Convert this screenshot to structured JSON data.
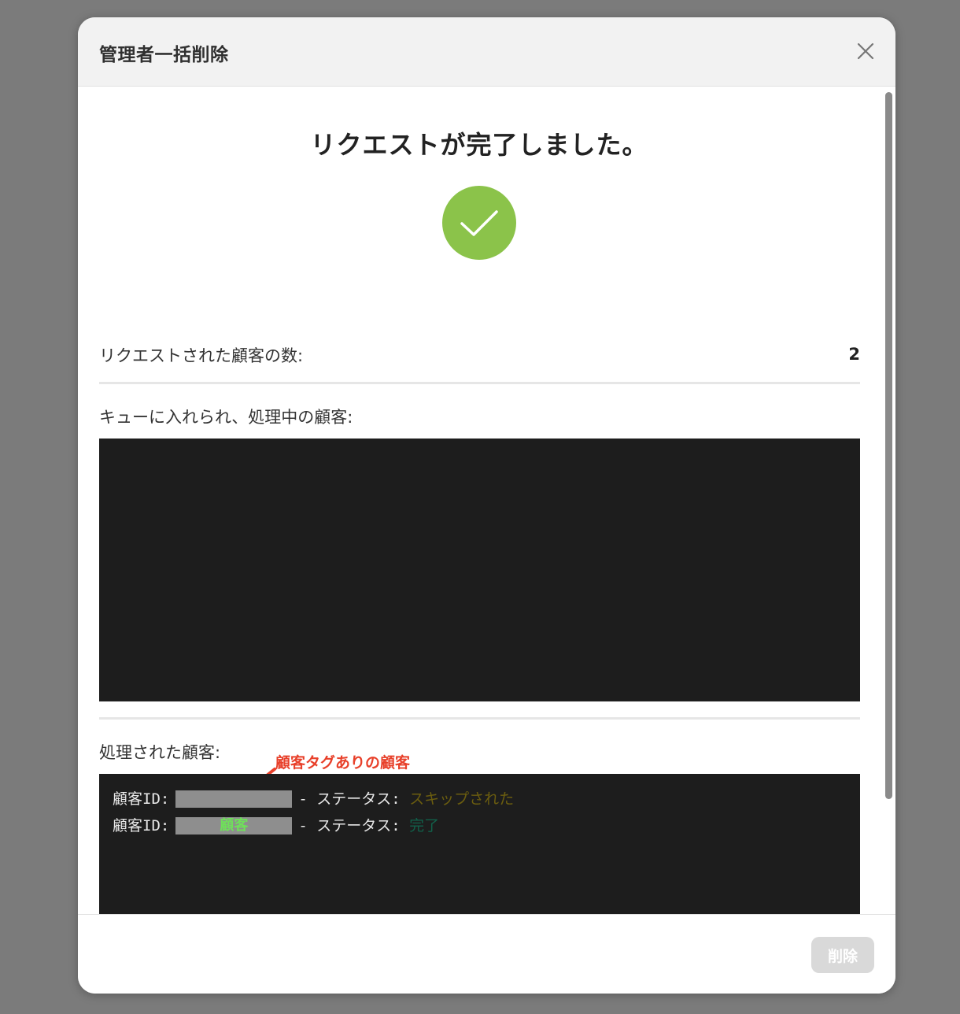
{
  "modal": {
    "title": "管理者一括削除",
    "close_icon": "close-icon"
  },
  "result": {
    "title": "リクエストが完了しました。",
    "success_icon": "check-icon",
    "success_color": "#8bc34a"
  },
  "summary": {
    "requested_label": "リクエストされた顧客の数:",
    "requested_count": "2",
    "queued_label": "キューに入れられ、処理中の顧客:",
    "processed_label": "処理された顧客:"
  },
  "processed_log": [
    {
      "id_label": "顧客ID:",
      "id_overlay": "",
      "separator": "- ステータス:",
      "status": "スキップされた",
      "status_color": "#6b5d0f"
    },
    {
      "id_label": "顧客ID:",
      "id_overlay": "顧客",
      "separator": "- ステータス:",
      "status": "完了",
      "status_color": "#11604a"
    }
  ],
  "annotation": {
    "text": "顧客タグありの顧客",
    "color": "#e8402a"
  },
  "footer": {
    "delete_label": "削除"
  }
}
